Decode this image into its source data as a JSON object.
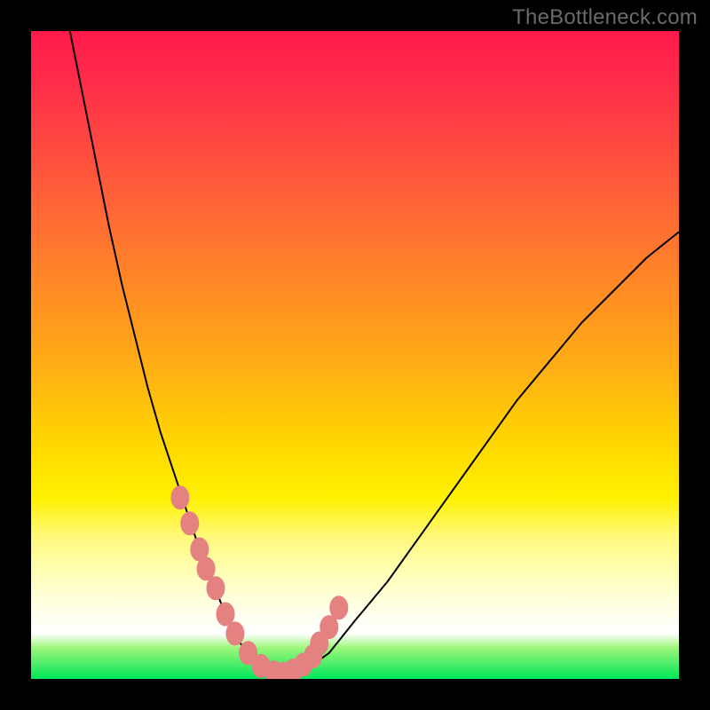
{
  "watermark": "TheBottleneck.com",
  "chart_data": {
    "type": "line",
    "title": "",
    "xlabel": "",
    "ylabel": "",
    "xlim": [
      0,
      100
    ],
    "ylim": [
      0,
      100
    ],
    "grid": false,
    "legend": false,
    "notes": "Gradient heat background red→yellow→green. Black V-shaped curve with salmon bead markers near the valley.",
    "series": [
      {
        "name": "curve",
        "x": [
          6,
          8,
          10,
          12,
          14,
          16,
          18,
          20,
          22,
          24,
          26,
          28,
          30,
          32,
          34,
          36,
          38,
          42,
          46,
          50,
          55,
          60,
          65,
          70,
          75,
          80,
          85,
          90,
          95,
          100
        ],
        "y": [
          100,
          90,
          80,
          70,
          61,
          53,
          45,
          38,
          32,
          26,
          20,
          15,
          10,
          6,
          3,
          1,
          0.4,
          1.2,
          4,
          9,
          15,
          22,
          29,
          36,
          43,
          49,
          55,
          60,
          65,
          69
        ]
      }
    ],
    "markers": {
      "name": "beads",
      "color": "#e48282",
      "x": [
        23,
        24.5,
        26,
        27,
        28.5,
        30,
        31.5,
        33.5,
        35.5,
        37.5,
        39,
        40.5,
        42,
        43.5,
        44.5,
        46,
        47.5
      ],
      "y": [
        28,
        24,
        20,
        17,
        14,
        10,
        7,
        4,
        2,
        1,
        0.8,
        1.3,
        2.2,
        3.5,
        5.5,
        8,
        11
      ]
    },
    "gradient_stops": [
      {
        "pos": 0,
        "color": "#ff1a4b"
      },
      {
        "pos": 50,
        "color": "#ffb512"
      },
      {
        "pos": 72,
        "color": "#fff100"
      },
      {
        "pos": 93,
        "color": "#ffffff"
      },
      {
        "pos": 100,
        "color": "#00e65a"
      }
    ]
  }
}
